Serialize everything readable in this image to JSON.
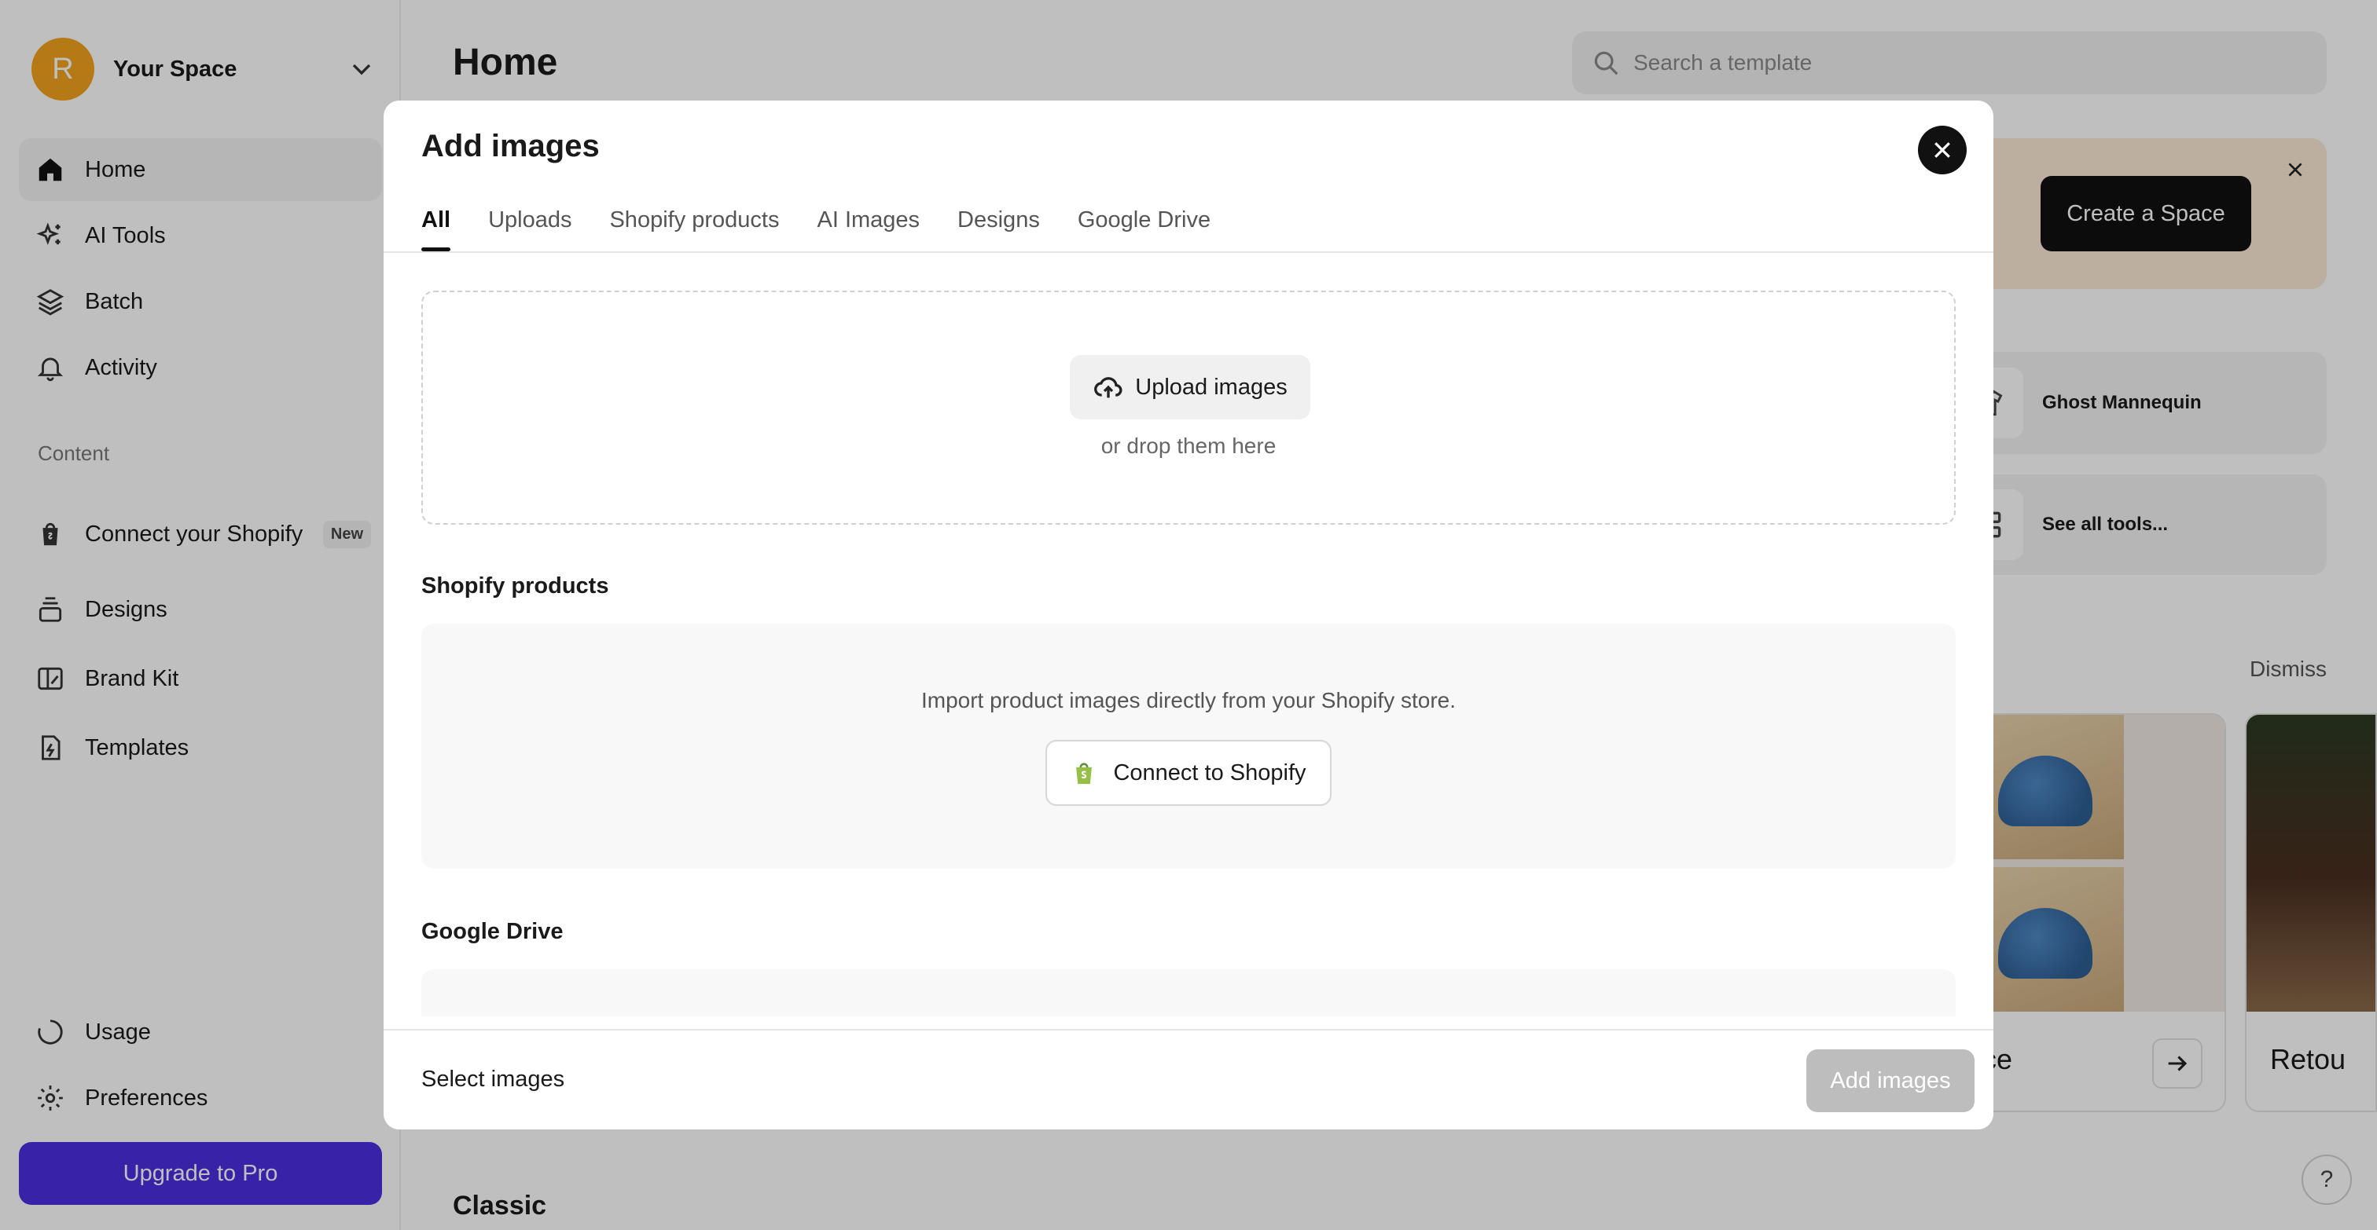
{
  "sidebar": {
    "space": {
      "avatar_letter": "R",
      "name": "Your Space"
    },
    "nav": [
      {
        "label": "Home"
      },
      {
        "label": "AI Tools"
      },
      {
        "label": "Batch"
      },
      {
        "label": "Activity"
      }
    ],
    "content_label": "Content",
    "content_items": [
      {
        "label": "Connect your Shopify",
        "badge": "New"
      },
      {
        "label": "Designs"
      },
      {
        "label": "Brand Kit"
      },
      {
        "label": "Templates"
      }
    ],
    "bottom_items": [
      {
        "label": "Usage"
      },
      {
        "label": "Preferences"
      }
    ],
    "upgrade_label": "Upgrade to Pro"
  },
  "main": {
    "title": "Home",
    "search_placeholder": "Search a template",
    "promo": {
      "create_label": "Create a Space"
    },
    "tools": [
      {
        "label": "Ghost Mannequin"
      },
      {
        "label": "See all tools..."
      }
    ],
    "dismiss_label": "Dismiss",
    "feature_cards": [
      {
        "label": "once"
      },
      {
        "label": "Retou"
      }
    ],
    "classic_heading": "Classic",
    "help_label": "?"
  },
  "modal": {
    "title": "Add images",
    "tabs": [
      {
        "label": "All",
        "active": true
      },
      {
        "label": "Uploads"
      },
      {
        "label": "Shopify products"
      },
      {
        "label": "AI Images"
      },
      {
        "label": "Designs"
      },
      {
        "label": "Google Drive"
      }
    ],
    "upload": {
      "button_label": "Upload images",
      "hint": "or drop them here"
    },
    "shopify": {
      "heading": "Shopify products",
      "hint": "Import product images directly from your Shopify store.",
      "button_label": "Connect to Shopify"
    },
    "drive": {
      "heading": "Google Drive"
    },
    "footer": {
      "select_label": "Select images",
      "add_button_label": "Add images"
    }
  },
  "colors": {
    "avatar": "#f2a31c",
    "upgrade_button": "#4b2fe0",
    "promo_bg": "#fbead6",
    "shopify_green": "#95bf47"
  }
}
